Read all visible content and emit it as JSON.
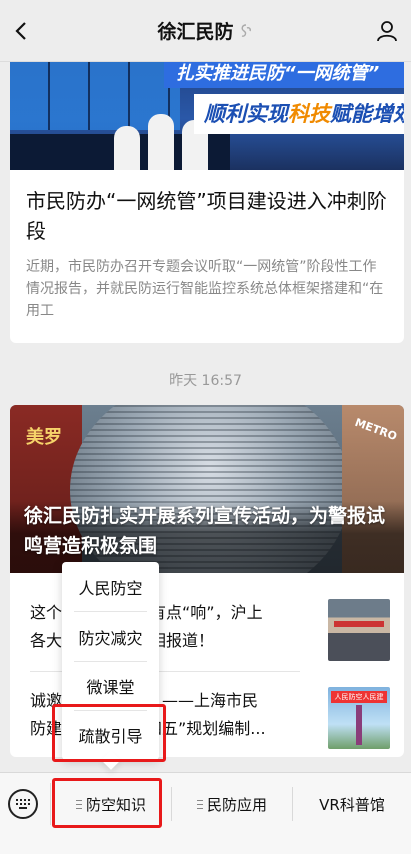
{
  "nav": {
    "title": "徐汇民防",
    "back_icon": "chevron-left-icon",
    "badge_icon": "verified-badge-icon",
    "user_icon": "user-profile-icon"
  },
  "article1": {
    "banner_line1": "扎实推进民防“一网统管”",
    "banner_line2_a": "顺利实现",
    "banner_line2_b": "科技",
    "banner_line2_c": "赋能增效",
    "headline": "市民防办“一网统管”项目建设进入冲刺阶段",
    "summary": "近期，市民防办召开专题会议听取“一网统管”阶段性工作情况报告，并就民防运行智能监控系统总体框架搭建和“在用工"
  },
  "timestamp": "昨天 16:57",
  "article2": {
    "sign_left": "美罗",
    "sign_right": "METRO",
    "headline": "徐汇民防扎实开展系列宣传活动，为警报试鸣营造积极氛围",
    "items": [
      {
        "text": "这个…有点“响”，沪上各大…相报道！",
        "line1_a": "这个",
        "line1_b": "有点“响”，沪上",
        "line2_a": "各大",
        "line2_b": "相报道！"
      },
      {
        "line1_a": "诚邀",
        "line1_b": "！——上海市民",
        "line2_a": "防建",
        "line2_b": "四五”规划编制...",
        "thumb_tag": "人民防空人民建"
      }
    ]
  },
  "popup": {
    "items": [
      "人民防空",
      "防灾减灾",
      "微课堂",
      "疏散引导"
    ]
  },
  "menubar": {
    "keyboard_icon": "keyboard-icon",
    "tabs": [
      "防空知识",
      "民防应用",
      "VR科普馆"
    ]
  },
  "colors": {
    "highlight": "#e8191a",
    "background": "#ededed"
  }
}
